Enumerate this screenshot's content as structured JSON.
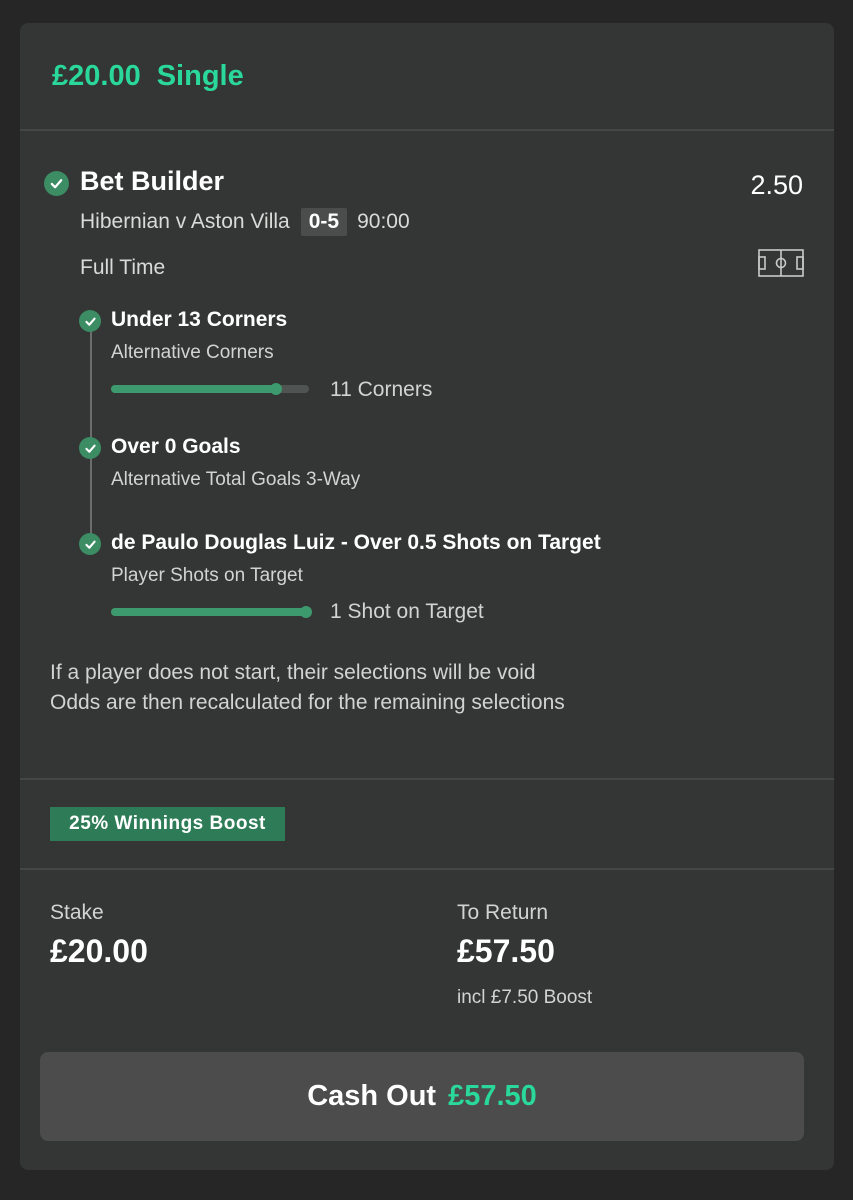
{
  "header": {
    "stake": "£20.00",
    "bet_type": "Single"
  },
  "bet": {
    "title": "Bet Builder",
    "odds": "2.50",
    "fixture": {
      "teams": "Hibernian v Aston Villa",
      "score": "0-5",
      "time": "90:00"
    },
    "market": "Full Time",
    "legs": [
      {
        "title": "Under 13 Corners",
        "subtitle": "Alternative Corners",
        "progress_label": "11 Corners",
        "progress": 0.85
      },
      {
        "title": "Over 0 Goals",
        "subtitle": "Alternative Total Goals 3-Way"
      },
      {
        "title": "de Paulo Douglas Luiz - Over 0.5 Shots on Target",
        "subtitle": "Player Shots on Target",
        "progress_label": "1 Shot on Target",
        "progress": 1.0
      }
    ],
    "void_note_line1": "If a player does not start, their selections will be void",
    "void_note_line2": "Odds are then recalculated for the remaining selections"
  },
  "boost": {
    "badge": "25% Winnings Boost"
  },
  "summary": {
    "stake_label": "Stake",
    "stake_value": "£20.00",
    "return_label": "To Return",
    "return_value": "£57.50",
    "boost_note": "incl £7.50 Boost"
  },
  "cashout": {
    "label": "Cash Out",
    "value": "£57.50"
  },
  "colors": {
    "accent": "#29d89a",
    "check": "#3c8c64",
    "badge": "#2e7c57",
    "card": "#333634"
  },
  "icons": [
    "check-circle-icon",
    "pitch-icon"
  ]
}
